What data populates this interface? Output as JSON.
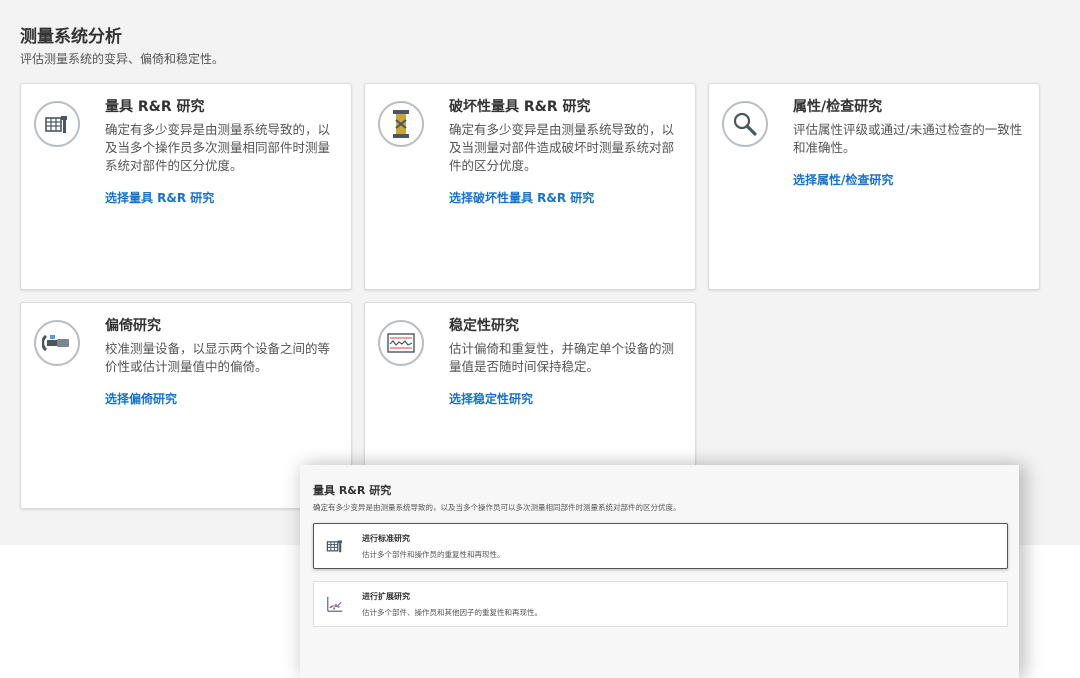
{
  "header": {
    "title": "测量系统分析",
    "subtitle": "评估测量系统的变异、偏倚和稳定性。"
  },
  "cards": [
    {
      "title": "量具 R&R 研究",
      "desc": "确定有多少变异是由测量系统导致的，以及当多个操作员多次测量相同部件时测量系统对部件的区分优度。",
      "link": "选择量具 R&R 研究",
      "icon": "gauge-table-icon"
    },
    {
      "title": "破坏性量具 R&R 研究",
      "desc": "确定有多少变异是由测量系统导致的，以及当测量对部件造成破坏时测量系统对部件的区分优度。",
      "link": "选择破坏性量具 R&R 研究",
      "icon": "destructive-test-icon"
    },
    {
      "title": "属性/检查研究",
      "desc": "评估属性评级或通过/未通过检查的一致性和准确性。",
      "link": "选择属性/检查研究",
      "icon": "magnifier-icon"
    },
    {
      "title": "偏倚研究",
      "desc": "校准测量设备，以显示两个设备之间的等价性或估计测量值中的偏倚。",
      "link": "选择偏倚研究",
      "icon": "micrometer-icon"
    },
    {
      "title": "稳定性研究",
      "desc": "估计偏倚和重复性，并确定单个设备的测量值是否随时间保持稳定。",
      "link": "选择稳定性研究",
      "icon": "control-chart-icon"
    }
  ],
  "overlay": {
    "title": "量具 R&R 研究",
    "desc": "确定有多少变异是由测量系统导致的，以及当多个操作员可以多次测量相同部件时测量系统对部件的区分优度。",
    "options": [
      {
        "title": "进行标准研究",
        "desc": "估计多个部件和操作员的重复性和再现性。",
        "icon": "gauge-table-icon",
        "selected": true
      },
      {
        "title": "进行扩展研究",
        "desc": "估计多个部件、操作员和其他因子的重复性和再现性。",
        "icon": "scatter-plot-icon",
        "selected": false
      }
    ]
  },
  "colors": {
    "link": "#1a73c8",
    "panel_bg": "#f3f3f3",
    "card_border": "#dcdcdc",
    "icon_ring": "#b9bec5"
  }
}
